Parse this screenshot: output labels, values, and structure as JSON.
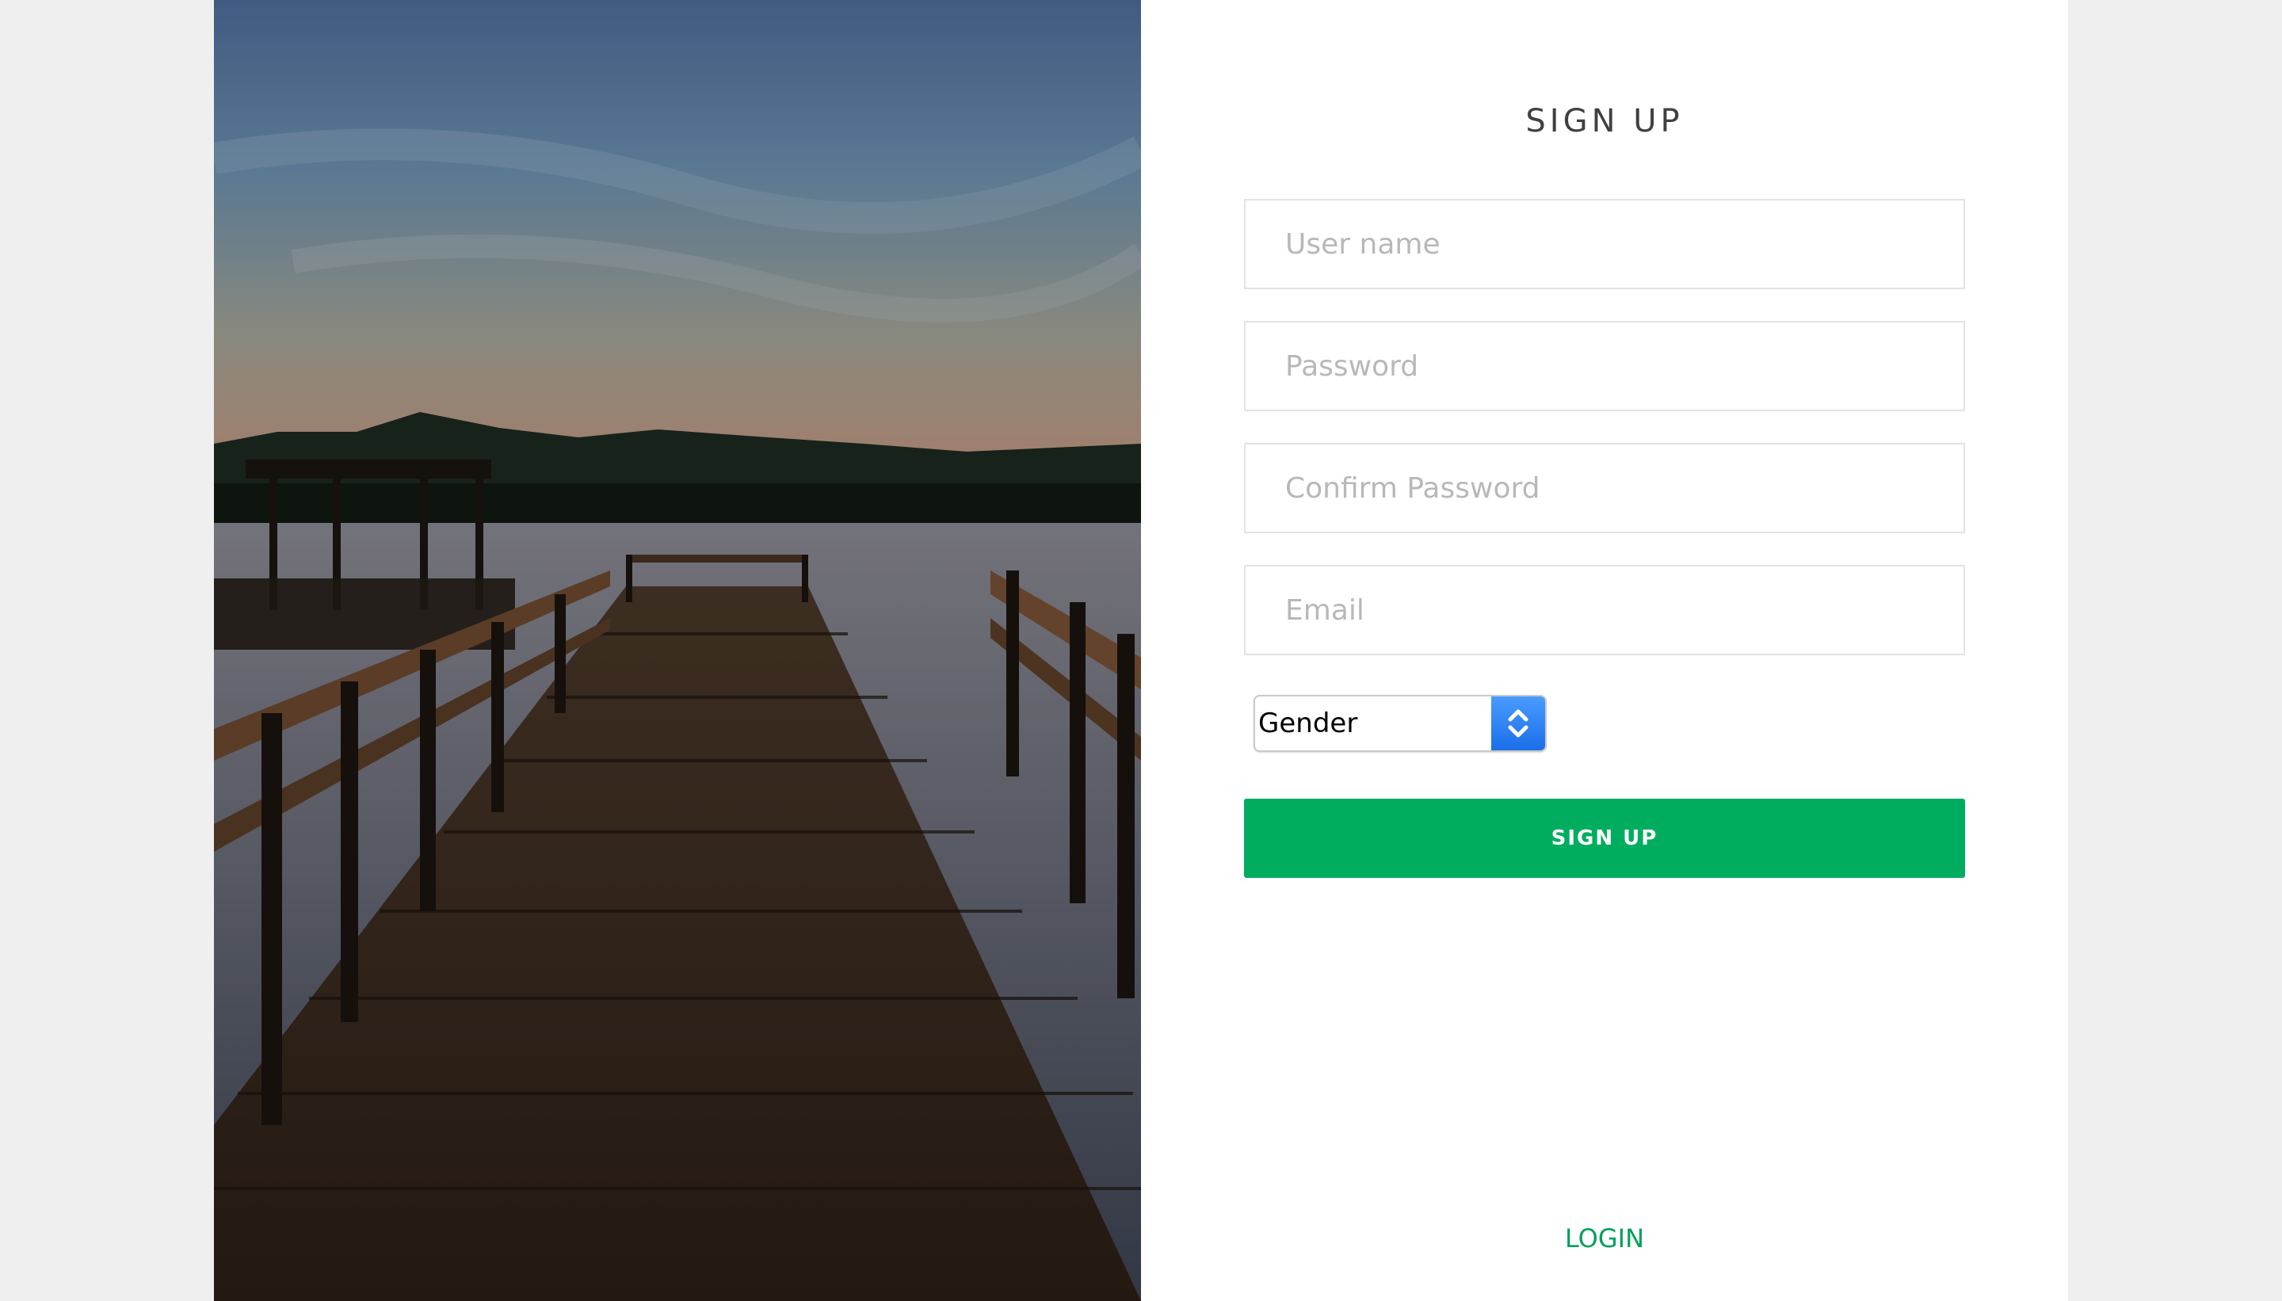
{
  "photo": {
    "description_icon": "pier-landscape-image"
  },
  "form": {
    "title": "SIGN UP",
    "fields": {
      "username_placeholder": "User name",
      "password_placeholder": "Password",
      "confirm_password_placeholder": "Confirm Password",
      "email_placeholder": "Email"
    },
    "gender_select": {
      "selected": "Gender"
    },
    "submit_label": "SIGN UP",
    "login_link": "LOGIN"
  },
  "colors": {
    "accent": "#00ad5f",
    "link": "#00a05a",
    "select_button": "#1a6fe8",
    "page_background": "#efefef"
  }
}
